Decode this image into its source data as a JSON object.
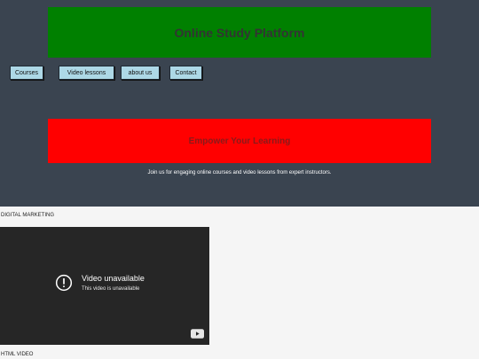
{
  "header": {
    "title": "Online Study Platform"
  },
  "nav": {
    "items": [
      {
        "label": "Courses"
      },
      {
        "label": "Video lessons"
      },
      {
        "label": "about us"
      },
      {
        "label": "Contact"
      }
    ]
  },
  "banner": {
    "headline": "Empower Your Learning",
    "tagline": "Join us for engaging online courses and video lessons from expert instructors."
  },
  "sections": [
    {
      "label": "DIGITAL MARKETING",
      "video": {
        "message_title": "Video unavailable",
        "message_subtitle": "This video is unavailable",
        "status_icon": "alert-circle-icon",
        "brand_icon": "youtube-icon"
      }
    },
    {
      "label": "HTML VIDEO"
    }
  ],
  "colors": {
    "hero_bg": "#3a4450",
    "title_banner": "#008000",
    "red_banner": "#ff0000",
    "nav_button": "#add8e6",
    "video_bg": "#262626"
  }
}
